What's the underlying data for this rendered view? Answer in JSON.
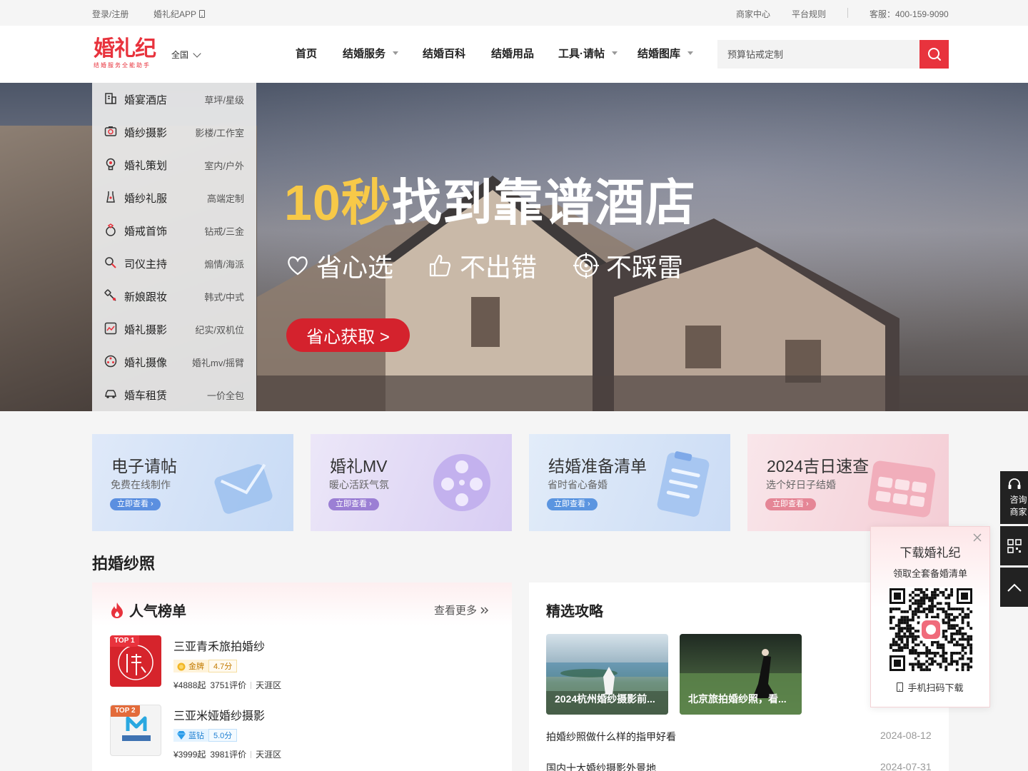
{
  "topbar": {
    "login": "登录/注册",
    "app": "婚礼纪APP",
    "merchant_center": "商家中心",
    "platform_rules": "平台规则",
    "service": "客服：400-159-9090"
  },
  "header": {
    "logo_text": "婚礼纪",
    "logo_slogan": "结婚服务全能助手",
    "city": "全国",
    "nav": [
      {
        "label": "首页",
        "dropdown": false
      },
      {
        "label": "结婚服务",
        "dropdown": true
      },
      {
        "label": "结婚百科",
        "dropdown": false
      },
      {
        "label": "结婚用品",
        "dropdown": false
      },
      {
        "label": "工具·请帖",
        "dropdown": true
      },
      {
        "label": "结婚图库",
        "dropdown": true
      }
    ],
    "search_placeholder": "预算钻戒定制"
  },
  "categories": [
    {
      "name": "婚宴酒店",
      "sub": "草坪/星级",
      "icon": "hotel-icon"
    },
    {
      "name": "婚纱摄影",
      "sub": "影楼/工作室",
      "icon": "camera-icon"
    },
    {
      "name": "婚礼策划",
      "sub": "室内/户外",
      "icon": "bulb-icon"
    },
    {
      "name": "婚纱礼服",
      "sub": "高端定制",
      "icon": "dress-icon"
    },
    {
      "name": "婚戒首饰",
      "sub": "钻戒/三金",
      "icon": "ring-icon"
    },
    {
      "name": "司仪主持",
      "sub": "煽情/海派",
      "icon": "microphone-icon"
    },
    {
      "name": "新娘跟妆",
      "sub": "韩式/中式",
      "icon": "makeup-brush-icon"
    },
    {
      "name": "婚礼摄影",
      "sub": "纪实/双机位",
      "icon": "photo-icon"
    },
    {
      "name": "婚礼摄像",
      "sub": "婚礼mv/摇臂",
      "icon": "film-reel-icon"
    },
    {
      "name": "婚车租赁",
      "sub": "一价全包",
      "icon": "car-icon"
    }
  ],
  "banner": {
    "headline_highlight": "10秒",
    "headline_rest": "找到靠谱酒店",
    "features": [
      "省心选",
      "不出错",
      "不踩雷"
    ],
    "cta": "省心获取 >"
  },
  "tool_cards": [
    {
      "title": "电子请帖",
      "subtitle": "免费在线制作",
      "button": "立即查看",
      "accent": "#5b8fe0"
    },
    {
      "title": "婚礼MV",
      "subtitle": "暖心活跃气氛",
      "button": "立即查看",
      "accent": "#9b7fd4"
    },
    {
      "title": "结婚准备清单",
      "subtitle": "省时省心备婚",
      "button": "立即查看",
      "accent": "#5b95e0"
    },
    {
      "title": "2024吉日速查",
      "subtitle": "选个好日子结婚",
      "button": "立即查看",
      "accent": "#e58696"
    }
  ],
  "section_title": "拍婚纱照",
  "popular": {
    "title": "人气榜单",
    "more": "查看更多",
    "items": [
      {
        "tag": "TOP 1",
        "name": "三亚青禾旅拍婚纱",
        "level": "金牌",
        "score": "4.7分",
        "price": "¥4888起",
        "reviews": "3751评价",
        "district": "天涯区"
      },
      {
        "tag": "TOP 2",
        "name": "三亚米娅婚纱摄影",
        "level": "蓝钻",
        "score": "5.0分",
        "price": "¥3999起",
        "reviews": "3981评价",
        "district": "天涯区"
      }
    ]
  },
  "guides": {
    "title": "精选攻略",
    "cards": [
      {
        "caption": "2024杭州婚纱摄影前..."
      },
      {
        "caption": "北京旅拍婚纱照，看..."
      }
    ],
    "articles": [
      {
        "title": "拍婚纱照做什么样的指甲好看",
        "date": "2024-08-12"
      },
      {
        "title": "国内十大婚纱摄影外景地",
        "date": "2024-07-31"
      }
    ]
  },
  "sidebar": {
    "consult_line1": "咨询",
    "consult_line2": "商家"
  },
  "download_popup": {
    "title": "下载婚礼纪",
    "subtitle": "领取全套备婚清单",
    "scan": "手机扫码下载"
  }
}
